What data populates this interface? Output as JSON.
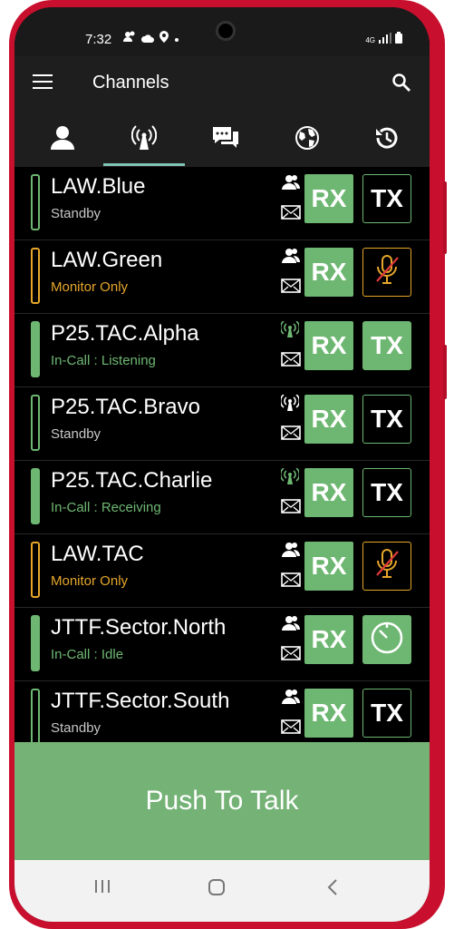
{
  "status_bar": {
    "time": "7:32",
    "left_icons": [
      "person-icon",
      "person-icon",
      "cloud-icon",
      "location-icon",
      "dot-icon"
    ],
    "right_icons": [
      "4g-lte-icon",
      "signal-icon",
      "battery-icon"
    ],
    "network_label": "4G"
  },
  "app_bar": {
    "title": "Channels",
    "menu_icon": "menu-icon",
    "search_icon": "search-icon"
  },
  "tabs": [
    {
      "id": "contacts",
      "icon": "person-icon",
      "active": false
    },
    {
      "id": "channels",
      "icon": "radio-tower-icon",
      "active": true
    },
    {
      "id": "messages",
      "icon": "chat-icon",
      "active": false
    },
    {
      "id": "map",
      "icon": "globe-icon",
      "active": false
    },
    {
      "id": "history",
      "icon": "history-icon",
      "active": false
    }
  ],
  "channels": [
    {
      "name": "LAW.Blue",
      "status": "Standby",
      "status_color": "#c8c8c8",
      "indicator": "outline-green",
      "type_icon": "group-icon",
      "rx": "RX",
      "tx": "TX",
      "tx_state": "outline"
    },
    {
      "name": "LAW.Green",
      "status": "Monitor Only",
      "status_color": "#e6a72b",
      "indicator": "outline-orange",
      "type_icon": "group-icon",
      "rx": "RX",
      "tx": "",
      "tx_state": "muted"
    },
    {
      "name": "P25.TAC.Alpha",
      "status": "In-Call : Listening",
      "status_color": "#6eb772",
      "indicator": "filled-green",
      "type_icon": "radio-tower-icon",
      "rx": "RX",
      "tx": "TX",
      "tx_state": "filled"
    },
    {
      "name": "P25.TAC.Bravo",
      "status": "Standby",
      "status_color": "#c8c8c8",
      "indicator": "outline-green",
      "type_icon": "radio-tower-icon",
      "rx": "RX",
      "tx": "TX",
      "tx_state": "outline"
    },
    {
      "name": "P25.TAC.Charlie",
      "status": "In-Call : Receiving",
      "status_color": "#6eb772",
      "indicator": "filled-green",
      "type_icon": "radio-tower-icon",
      "rx": "RX",
      "tx": "TX",
      "tx_state": "outline"
    },
    {
      "name": "LAW.TAC",
      "status": "Monitor Only",
      "status_color": "#e6a72b",
      "indicator": "outline-orange",
      "type_icon": "group-icon",
      "rx": "RX",
      "tx": "",
      "tx_state": "muted"
    },
    {
      "name": "JTTF.Sector.North",
      "status": "In-Call : Idle",
      "status_color": "#6eb772",
      "indicator": "filled-green",
      "type_icon": "group-icon",
      "rx": "RX",
      "tx": "",
      "tx_state": "timer"
    },
    {
      "name": "JTTF.Sector.South",
      "status": "Standby",
      "status_color": "#c8c8c8",
      "indicator": "outline-green",
      "type_icon": "group-icon",
      "rx": "RX",
      "tx": "TX",
      "tx_state": "outline"
    }
  ],
  "ptt": {
    "label": "Push To Talk"
  },
  "colors": {
    "green": "#6eb772",
    "orange": "#e6a72b",
    "ptt_bg": "#74b276",
    "tab_underline": "#7ec4b7"
  },
  "nav": [
    "recents-icon",
    "home-icon",
    "back-icon"
  ]
}
